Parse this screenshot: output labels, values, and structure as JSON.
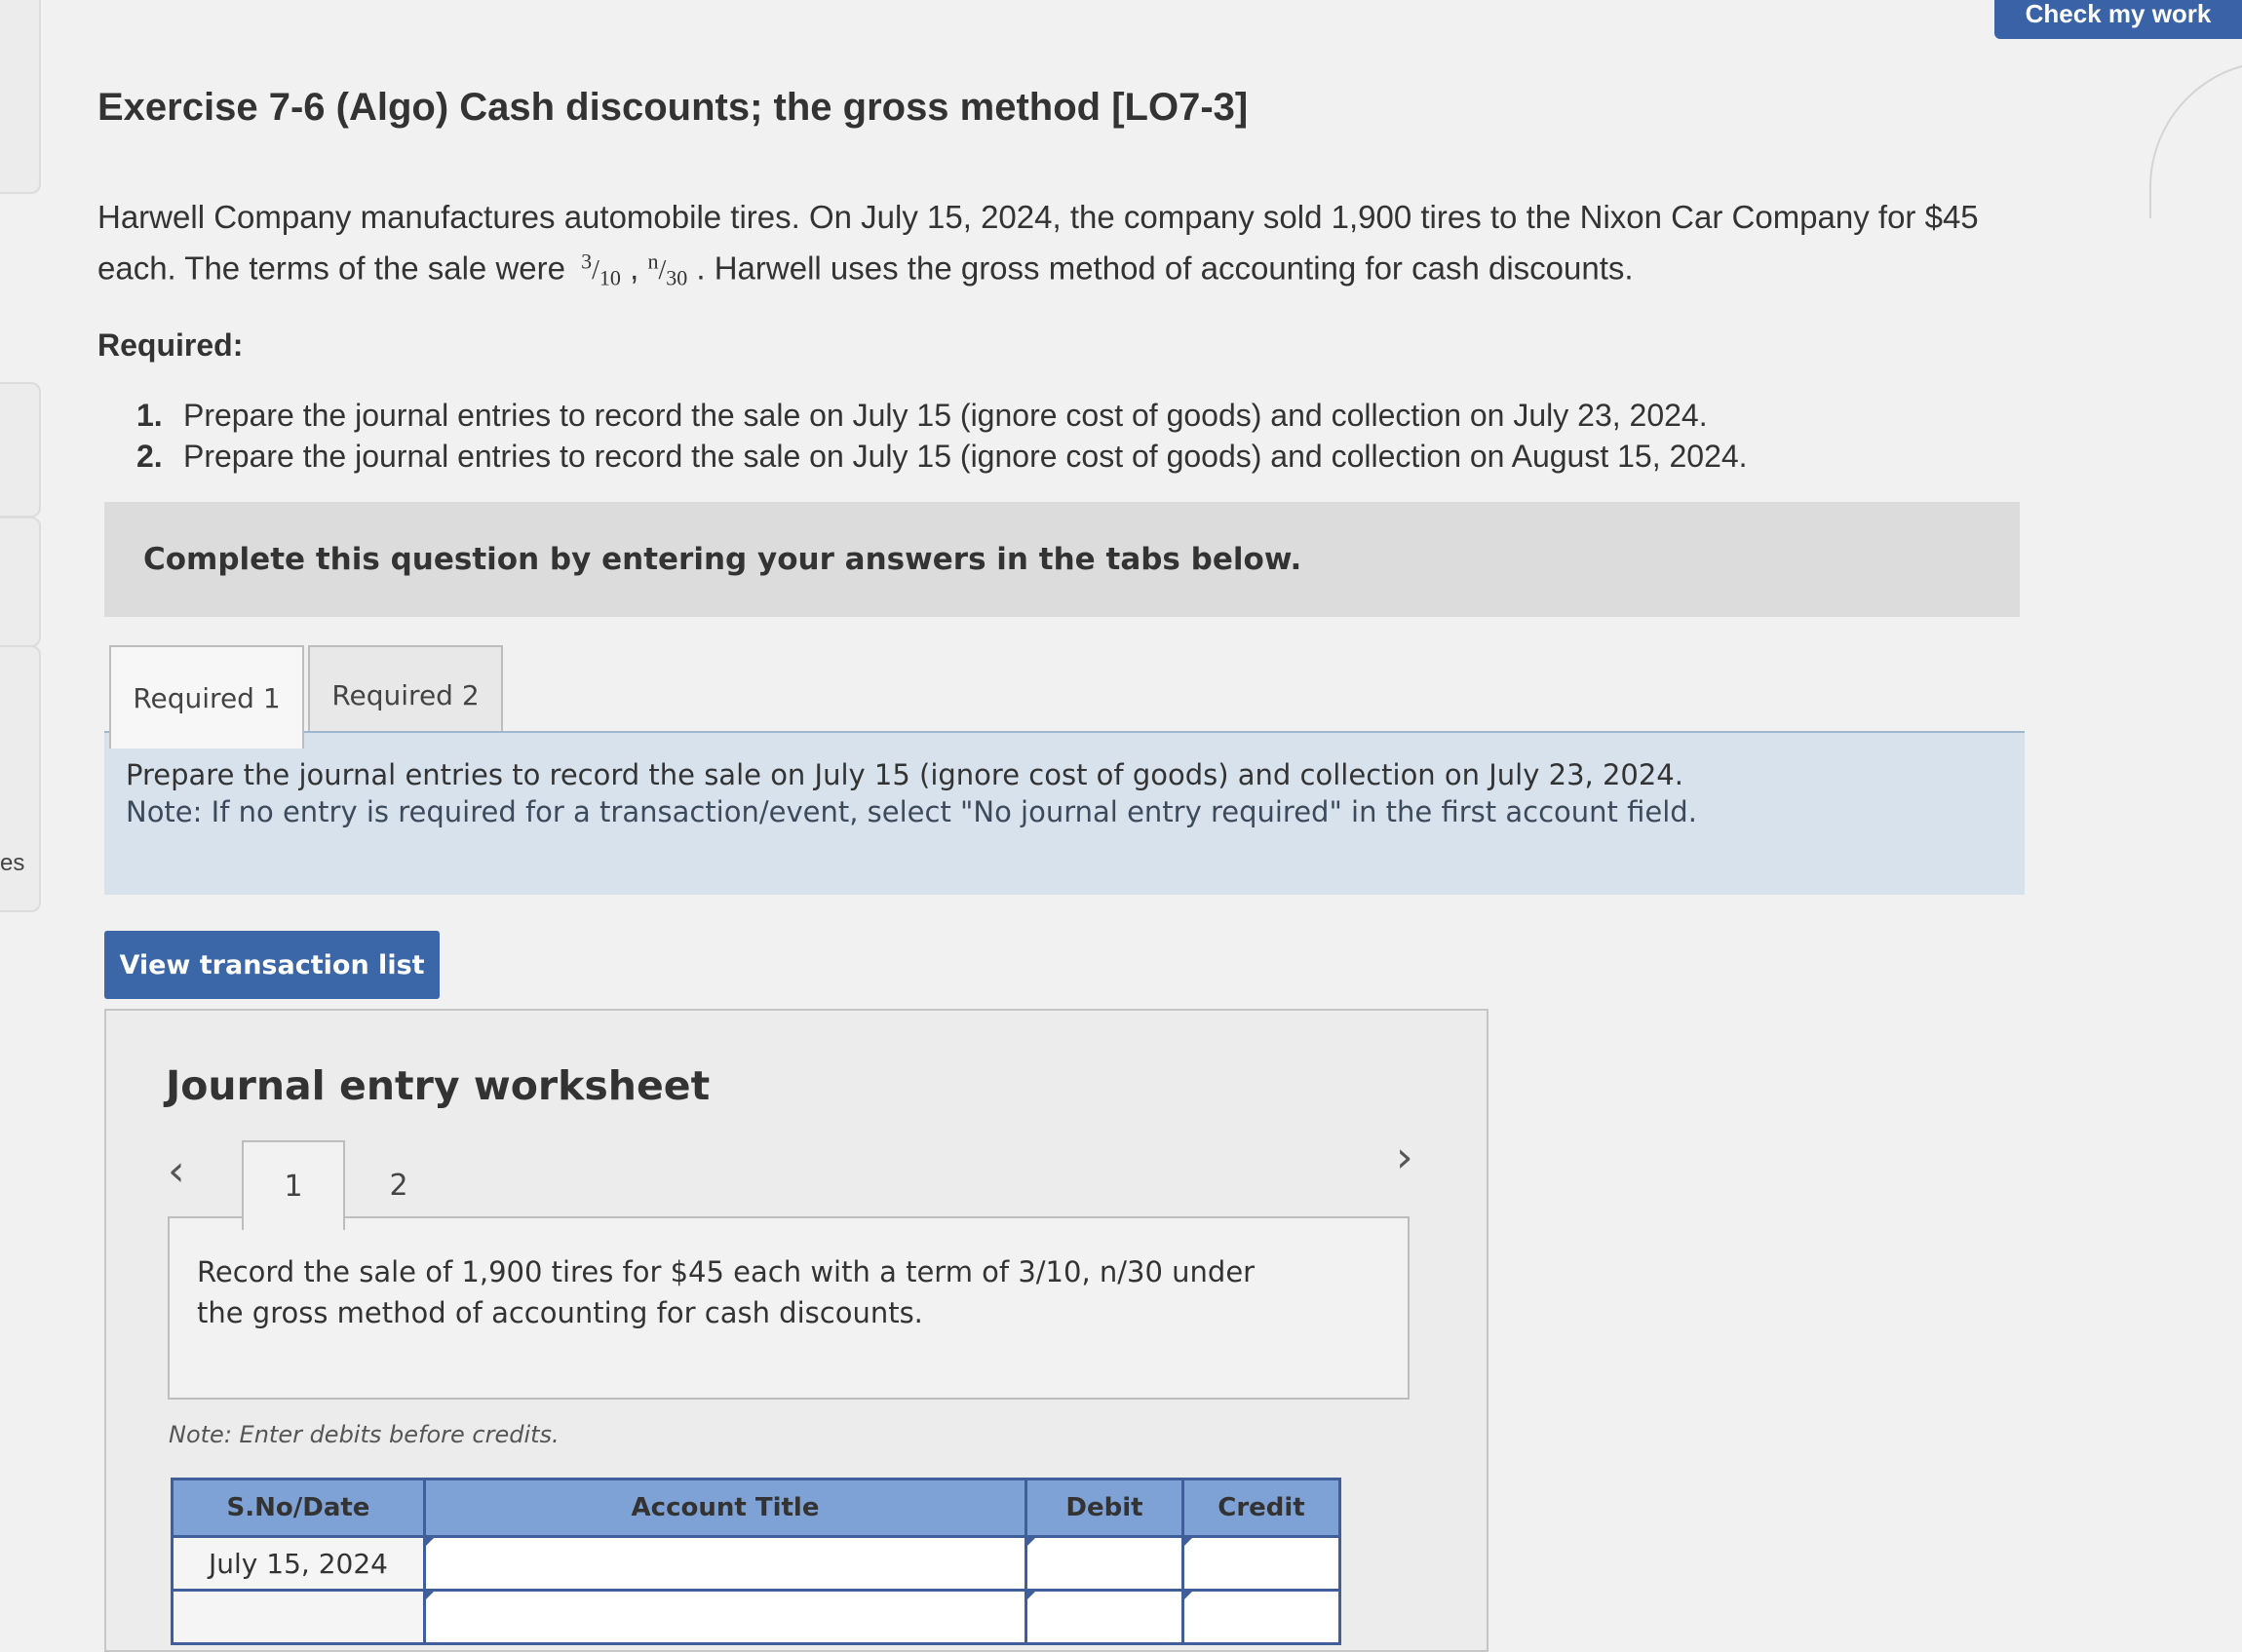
{
  "header": {
    "check_button": "Check my work",
    "left_edge_text": "es"
  },
  "exercise": {
    "title": "Exercise 7-6 (Algo) Cash discounts; the gross method [LO7-3]",
    "intro_line1": "Harwell Company manufactures automobile tires. On July 15, 2024, the company sold 1,900 tires to the Nixon Car Company for $45",
    "intro_line2_pre": "each. The terms of the sale were",
    "term1_num": "3",
    "term1_den": "10",
    "term_sep": ",",
    "term2_num": "n",
    "term2_den": "30",
    "intro_line2_post": ". Harwell uses the gross method of accounting for cash discounts.",
    "required_heading": "Required:",
    "requirements": [
      {
        "num": "1.",
        "text": "Prepare the journal entries to record the sale on July 15 (ignore cost of goods) and collection on July 23, 2024."
      },
      {
        "num": "2.",
        "text": "Prepare the journal entries to record the sale on July 15 (ignore cost of goods) and collection on August 15, 2024."
      }
    ]
  },
  "instructions": {
    "complete_text": "Complete this question by entering your answers in the tabs below."
  },
  "tabs": [
    {
      "label": "Required 1",
      "active": true
    },
    {
      "label": "Required 2",
      "active": false
    }
  ],
  "panel": {
    "line1": "Prepare the journal entries to record the sale on July 15 (ignore cost of goods) and collection on July 23, 2024.",
    "line2": "Note: If no entry is required for a transaction/event, select \"No journal entry required\" in the first account field."
  },
  "view_button": "View transaction list",
  "worksheet": {
    "title": "Journal entry worksheet",
    "prev_icon": "‹",
    "next_icon": "›",
    "pages": [
      "1",
      "2"
    ],
    "description_line1": "Record the sale of 1,900 tires for $45 each with a term of 3/10, n/30 under",
    "description_line2": "the gross method of accounting for cash discounts.",
    "note": "Note: Enter debits before credits.",
    "table": {
      "headers": [
        "S.No/Date",
        "Account Title",
        "Debit",
        "Credit"
      ],
      "rows": [
        {
          "date": "July 15, 2024",
          "account": "",
          "debit": "",
          "credit": ""
        },
        {
          "date": "",
          "account": "",
          "debit": "",
          "credit": ""
        }
      ]
    }
  },
  "colors": {
    "primary_button": "#3b66a8",
    "table_header": "#7fa2d6",
    "panel_bg": "#d7e2ed"
  }
}
